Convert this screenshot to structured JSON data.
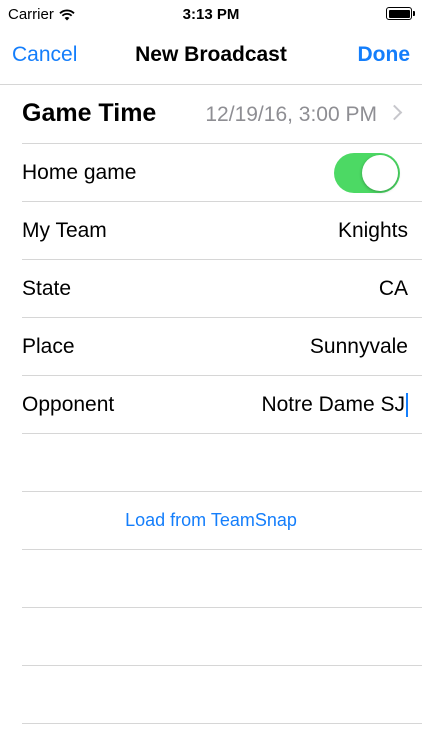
{
  "status_bar": {
    "carrier": "Carrier",
    "time": "3:13 PM"
  },
  "nav": {
    "cancel_label": "Cancel",
    "title": "New Broadcast",
    "done_label": "Done"
  },
  "form": {
    "game_time": {
      "label": "Game Time",
      "value": "12/19/16, 3:00 PM"
    },
    "home_game": {
      "label": "Home game",
      "on": true
    },
    "my_team": {
      "label": "My Team",
      "value": "Knights"
    },
    "state": {
      "label": "State",
      "value": "CA"
    },
    "place": {
      "label": "Place",
      "value": "Sunnyvale"
    },
    "opponent": {
      "label": "Opponent",
      "value": "Notre Dame SJ"
    }
  },
  "load_link": "Load from TeamSnap",
  "colors": {
    "accent": "#147efb",
    "toggle_on": "#4cd964",
    "separator": "#d6d6d6",
    "secondary_text": "#8e8e93"
  }
}
